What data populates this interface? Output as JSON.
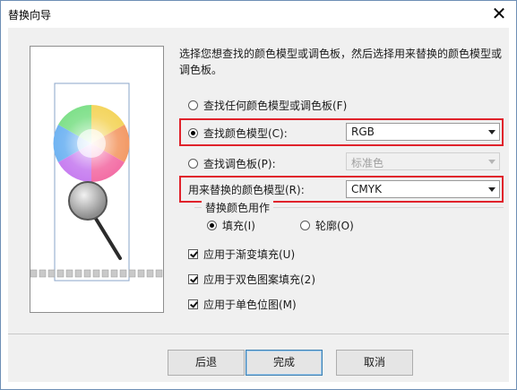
{
  "window": {
    "title": "替换向导",
    "close_glyph": "✕"
  },
  "description": "选择您想查找的颜色模型或调色板，然后选择用来替换的颜色模型或调色板。",
  "options": {
    "find_any_label": "查找任何颜色模型或调色板(F)",
    "find_model_label": "查找颜色模型(C):",
    "find_model_value": "RGB",
    "find_palette_label": "查找调色板(P):",
    "find_palette_value": "标准色",
    "replace_model_label": "用来替换的颜色模型(R):",
    "replace_model_value": "CMYK",
    "selected": "find_model"
  },
  "replace_as": {
    "group_label": "替换颜色用作",
    "fill_label": "填充(I)",
    "outline_label": "轮廓(O)",
    "selected": "fill"
  },
  "checkboxes": [
    {
      "label": "应用于渐变填充(U)",
      "checked": true
    },
    {
      "label": "应用于双色图案填充(2)",
      "checked": true
    },
    {
      "label": "应用于单色位图(M)",
      "checked": true
    }
  ],
  "buttons": {
    "back": "后退",
    "finish": "完成",
    "cancel": "取消"
  },
  "colors": {
    "highlight": "#e0222b",
    "default_button_border": "#3c7fb1"
  }
}
